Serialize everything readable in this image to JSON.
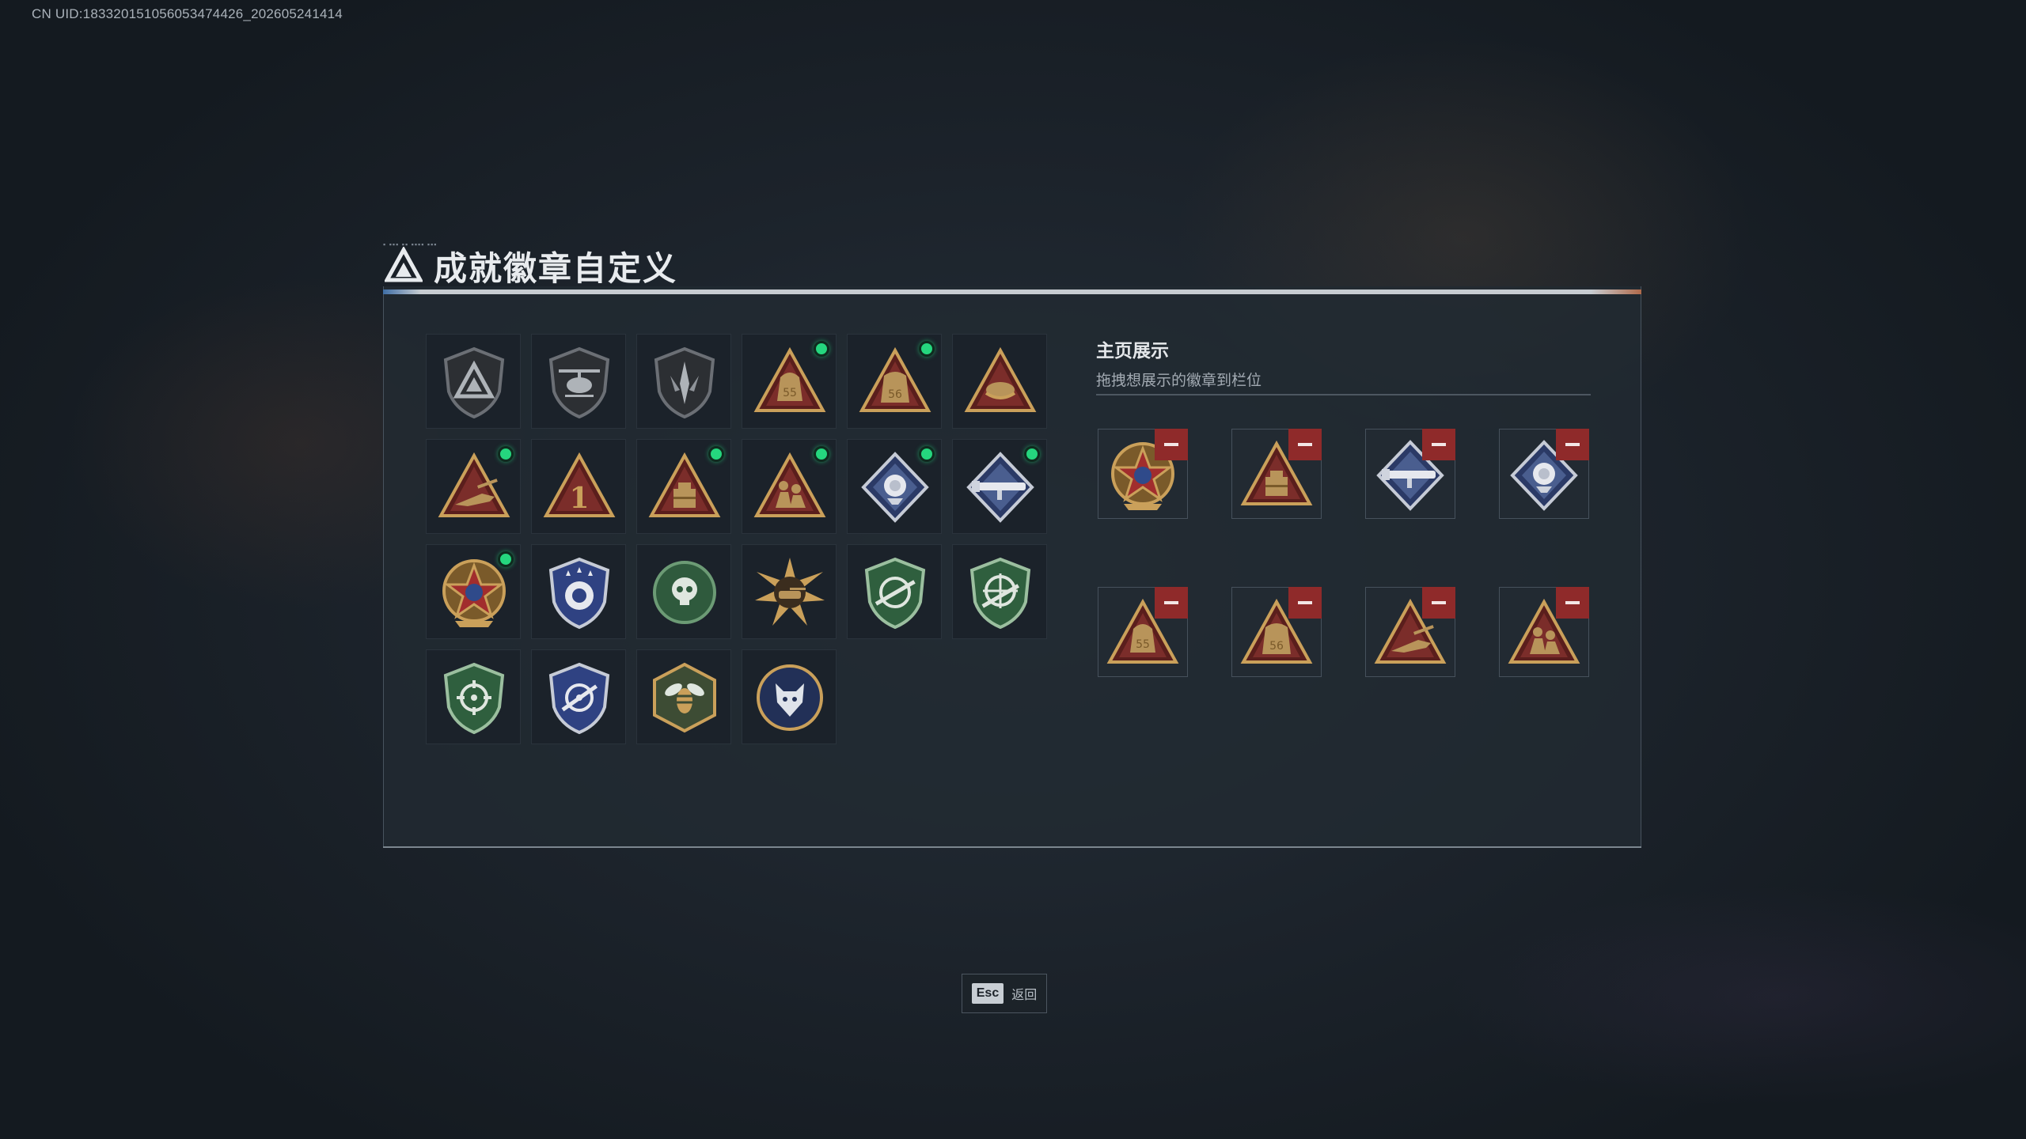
{
  "header": {
    "uid": "CN UID:18332015105605347442​6_202605241414",
    "title": "成就徽章自定义"
  },
  "badge_grid": {
    "rows": [
      [
        {
          "icon": "triangle-shield-badge-icon",
          "new": false
        },
        {
          "icon": "helicopter-shield-badge-icon",
          "new": false
        },
        {
          "icon": "blade-shield-badge-icon",
          "new": false
        },
        {
          "icon": "bag-55-triangle-badge-icon",
          "new": true
        },
        {
          "icon": "bag-56-triangle-badge-icon",
          "new": true
        },
        {
          "icon": "hand-triangle-badge-icon",
          "new": false
        }
      ],
      [
        {
          "icon": "prone-soldier-triangle-badge-icon",
          "new": true
        },
        {
          "icon": "number-1-triangle-badge-icon",
          "new": false
        },
        {
          "icon": "crate-triangle-badge-icon",
          "new": true
        },
        {
          "icon": "soldiers-triangle-badge-icon",
          "new": true
        },
        {
          "icon": "rose-diamond-badge-icon",
          "new": true
        },
        {
          "icon": "launcher-diamond-badge-icon",
          "new": true
        }
      ],
      [
        {
          "icon": "star-medal-badge-icon",
          "new": true
        },
        {
          "icon": "stars-shield-badge-icon",
          "new": false
        },
        {
          "icon": "skull-wreath-badge-icon",
          "new": false
        },
        {
          "icon": "sunburst-tank-badge-icon",
          "new": false
        },
        {
          "icon": "rifle-green-shield-badge-icon",
          "new": false
        },
        {
          "icon": "sniper-green-shield-badge-icon",
          "new": false
        }
      ],
      [
        {
          "icon": "crosshair-green-shield-badge-icon",
          "new": false
        },
        {
          "icon": "crosshair-blue-shield-badge-icon",
          "new": false
        },
        {
          "icon": "bee-hexagon-badge-icon",
          "new": false
        },
        {
          "icon": "wolf-circle-badge-icon",
          "new": false
        }
      ]
    ]
  },
  "showcase": {
    "title": "主页展示",
    "subtitle": "拖拽想展示的徽章到栏位",
    "slots": [
      "star-medal-badge-icon",
      "crate-triangle-badge-icon",
      "launcher-diamond-badge-icon",
      "rose-diamond-badge-icon",
      "bag-55-triangle-badge-icon",
      "bag-56-triangle-badge-icon",
      "prone-soldier-triangle-badge-icon",
      "soldiers-triangle-badge-icon"
    ]
  },
  "footer": {
    "esc_key": "Esc",
    "esc_label": "返回"
  },
  "colors": {
    "new_dot": "#25d67e",
    "remove_button": "#8f2a2a",
    "gold": "#caa05a",
    "green_shield": "#3f7d52",
    "blue_shield": "#3a4f8f"
  }
}
